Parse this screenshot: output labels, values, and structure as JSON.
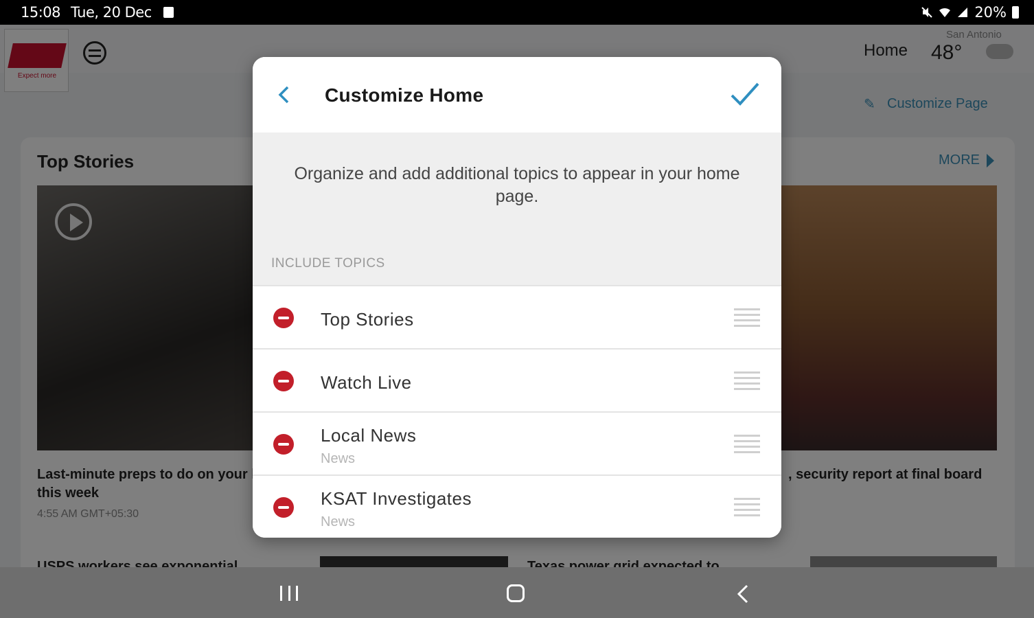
{
  "status_bar": {
    "time": "15:08",
    "date": "Tue, 20 Dec",
    "battery": "20%"
  },
  "app": {
    "logo_subtitle": "Expect more",
    "nav_home": "Home",
    "weather": {
      "city": "San Antonio",
      "temp": "48°"
    },
    "customize_page_label": "Customize Page",
    "top_stories": {
      "title": "Top Stories",
      "more_label": "MORE",
      "story_left": {
        "headline": "Last-minute preps to do on your h this week",
        "time": "4:55 AM GMT+05:30"
      },
      "story_right": {
        "headline": ", security report at final board"
      },
      "next_left": "USPS workers see exponential",
      "next_right": "Texas power grid expected to"
    }
  },
  "dialog": {
    "title": "Customize Home",
    "description": "Organize and add additional topics to appear in your home page.",
    "section_label": "INCLUDE TOPICS",
    "topics": [
      {
        "name": "Top Stories",
        "sub": ""
      },
      {
        "name": "Watch Live",
        "sub": ""
      },
      {
        "name": "Local News",
        "sub": "News"
      },
      {
        "name": "KSAT Investigates",
        "sub": "News"
      }
    ]
  },
  "colors": {
    "accent": "#3a8fb7",
    "remove": "#c21f2a",
    "dialog_bg": "#ffffff",
    "description_bg": "#efefef"
  }
}
